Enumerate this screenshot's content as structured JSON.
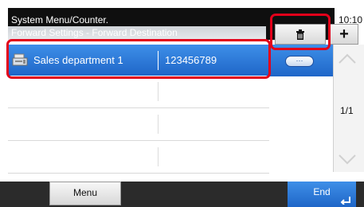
{
  "header": {
    "title": "System Menu/Counter.",
    "subtitle": "Forward Settings - Forward Destination",
    "time": "10:10"
  },
  "toolbar": {
    "delete_icon": "trash-icon",
    "add_label": "+"
  },
  "list": {
    "rows": [
      {
        "name": "Sales department 1",
        "number": "123456789",
        "selected": true
      },
      {
        "name": "",
        "number": "",
        "selected": false
      },
      {
        "name": "",
        "number": "",
        "selected": false
      },
      {
        "name": "",
        "number": "",
        "selected": false
      }
    ],
    "detail_label": "···"
  },
  "pager": {
    "page": "1/1",
    "up_icon": "chevron-up-icon",
    "down_icon": "chevron-down-icon"
  },
  "footer": {
    "menu_label": "Menu",
    "end_label": "End",
    "end_icon": "enter-icon"
  },
  "colors": {
    "selection_blue": "#1f66c8",
    "highlight_red": "#e2001a"
  }
}
